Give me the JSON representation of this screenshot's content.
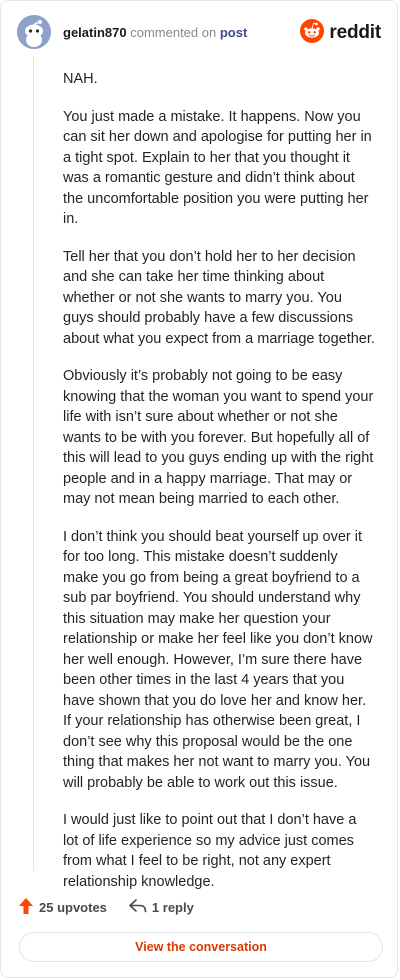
{
  "header": {
    "username": "gelatin870",
    "action_text": "commented on",
    "post_link": "post",
    "brand": "reddit"
  },
  "comment": {
    "paragraphs": [
      "NAH.",
      "You just made a mistake. It happens. Now you can sit her down and apologise for putting her in a tight spot. Explain to her that you thought it was a romantic gesture and didn’t think about the uncomfortable position you were putting her in.",
      "Tell her that you don’t hold her to her decision and she can take her time thinking about whether or not she wants to marry you. You guys should probably have a few discussions about what you expect from a marriage together.",
      "Obviously it’s probably not going to be easy knowing that the woman you want to spend your life with isn’t sure about whether or not she wants to be with you forever. But hopefully all of this will lead to you guys ending up with the right people and in a happy marriage. That may or may not mean being married to each other.",
      "I don’t think you should beat yourself up over it for too long. This mistake doesn’t suddenly make you go from being a great boyfriend to a sub par boyfriend. You should understand why this situation may make her question your relationship or make her feel like you don’t know her well enough. However, I’m sure there have been other times in the last 4 years that you have shown that you do love her and know her. If your relationship has otherwise been great, I don’t see why this proposal would be the one thing that makes her not want to marry you. You will probably be able to work out this issue.",
      "I would just like to point out that I don’t have a lot of life experience so my advice just comes from what I feel to be right, not any expert relationship knowledge."
    ]
  },
  "footer": {
    "upvotes": "25 upvotes",
    "replies": "1 reply",
    "cta": "View the conversation"
  },
  "colors": {
    "accent": "#d93a00",
    "upvote": "#ff4500",
    "reddit_orange": "#ff4500",
    "avatar": "#8ea2c9"
  },
  "icons": {
    "avatar": "snoo-avatar-icon",
    "brand": "reddit-logo-icon",
    "upvote": "upvote-arrow-icon",
    "reply": "reply-arrow-icon"
  }
}
